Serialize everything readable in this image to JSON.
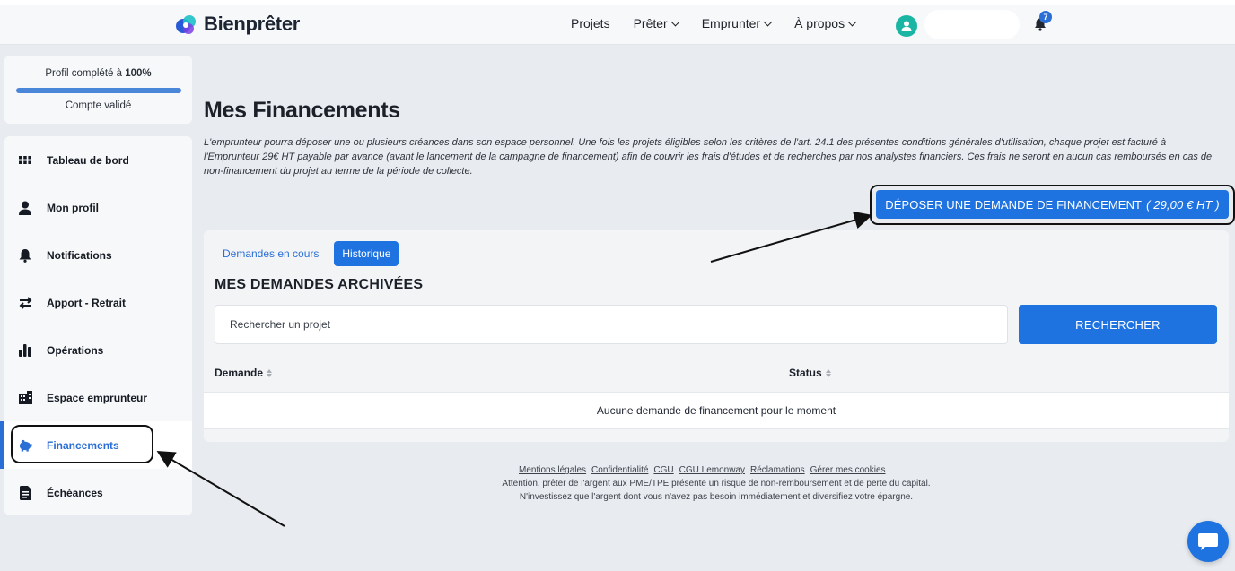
{
  "header": {
    "brand": "Bienprêter",
    "nav": [
      {
        "label": "Projets",
        "dropdown": false
      },
      {
        "label": "Prêter",
        "dropdown": true
      },
      {
        "label": "Emprunter",
        "dropdown": true
      },
      {
        "label": "À propos",
        "dropdown": true
      }
    ],
    "notification_count": "7",
    "colors": {
      "brand_blue": "#2b6fd6",
      "avatar": "#1bb5a4"
    }
  },
  "profile": {
    "completion_prefix": "Profil complété à ",
    "completion_value": "100%",
    "progress_fraction": 1.0,
    "status": "Compte validé"
  },
  "sidebar": {
    "items": [
      {
        "label": "Tableau de bord",
        "icon": "grid-icon"
      },
      {
        "label": "Mon profil",
        "icon": "user-icon"
      },
      {
        "label": "Notifications",
        "icon": "bell-icon"
      },
      {
        "label": "Apport - Retrait",
        "icon": "transfer-arrows-icon"
      },
      {
        "label": "Opérations",
        "icon": "bar-chart-icon"
      },
      {
        "label": "Espace emprunteur",
        "icon": "building-icon"
      },
      {
        "label": "Financements",
        "icon": "piggy-bank-icon",
        "active": true
      },
      {
        "label": "Échéances",
        "icon": "document-icon"
      }
    ]
  },
  "main": {
    "title": "Mes Financements",
    "disclaimer": "L'emprunteur pourra déposer une ou plusieurs créances dans son espace personnel. Une fois les projets éligibles selon les critères de l'art. 24.1 des présentes conditions générales d'utilisation, chaque projet est facturé à l'Emprunteur 29€ HT payable par avance (avant le lancement de la campagne de financement) afin de couvrir les frais d'études et de recherches par nos analystes financiers. Ces frais ne seront en aucun cas remboursés en cas de non-financement du projet au terme de la période de collecte.",
    "deposit_button": {
      "label": "DÉPOSER UNE DEMANDE DE FINANCEMENT",
      "price": "( 29,00 € HT )"
    },
    "tabs": [
      {
        "label": "Demandes en cours",
        "active": false
      },
      {
        "label": "Historique",
        "active": true
      }
    ],
    "section_title": "MES DEMANDES ARCHIVÉES",
    "search": {
      "placeholder": "Rechercher un projet",
      "value": "",
      "button": "RECHERCHER"
    },
    "table": {
      "columns": [
        "Demande",
        "Status"
      ],
      "empty_message": "Aucune demande de financement pour le moment"
    }
  },
  "footer": {
    "links": [
      "Mentions légales",
      "Confidentialité",
      "CGU",
      "CGU Lemonway",
      "Réclamations",
      "Gérer mes cookies"
    ],
    "warning_1": "Attention, prêter de l'argent aux PME/TPE présente un risque de non-remboursement et de perte du capital.",
    "warning_2": "N'investissez que l'argent dont vous n'avez pas besoin immédiatement et diversifiez votre épargne."
  }
}
